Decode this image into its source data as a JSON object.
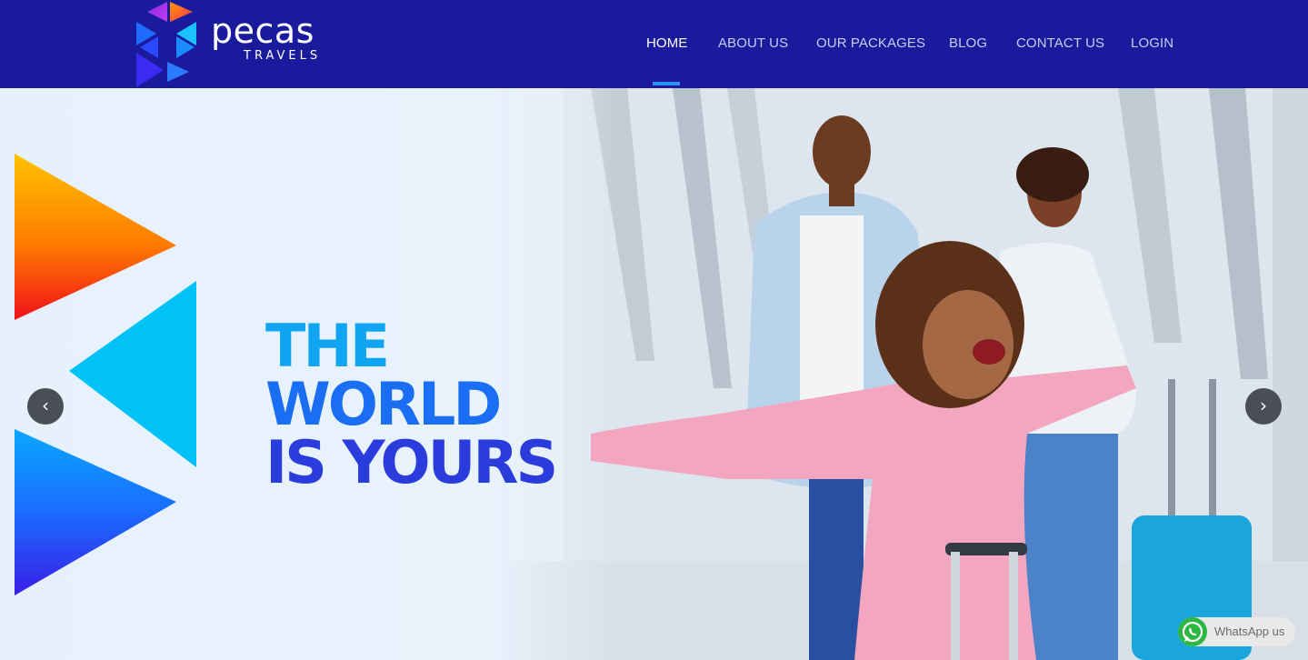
{
  "brand": {
    "name": "pecas",
    "tagline": "TRAVELS",
    "colors": {
      "header_bg": "#1a1a9c",
      "accent": "#2f8ef5"
    }
  },
  "nav": {
    "items": [
      {
        "label": "HOME",
        "active": true
      },
      {
        "label": "ABOUT US",
        "active": false
      },
      {
        "label": "OUR PACKAGES",
        "active": false
      },
      {
        "label": "BLOG",
        "active": false
      },
      {
        "label": "CONTACT US",
        "active": false
      },
      {
        "label": "LOGIN",
        "active": false
      }
    ]
  },
  "hero": {
    "headline": [
      "THE",
      "WORLD",
      "IS YOURS"
    ],
    "prev_icon": "chevron-left-icon",
    "next_icon": "chevron-right-icon"
  },
  "whatsapp": {
    "label": "WhatsApp us",
    "icon": "whatsapp-icon"
  }
}
